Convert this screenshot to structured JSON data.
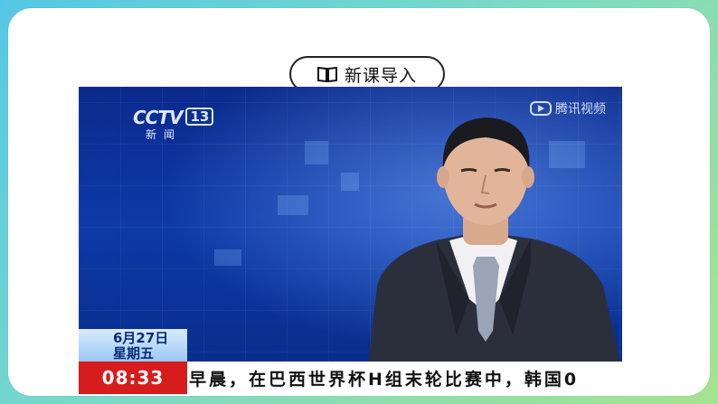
{
  "slide": {
    "section_title": "新课导入",
    "section_icon": "book-icon"
  },
  "video": {
    "channel_logo": "CCTV",
    "channel_number": "13",
    "channel_sub": "新闻",
    "watermark": "腾讯视频",
    "date_line1": "6月27日",
    "date_line2": "星期五",
    "time": "08:33",
    "ticker": "早晨，在巴西世界杯H组末轮比赛中，韩国0"
  },
  "colors": {
    "accent_teal": "#55c7e6",
    "accent_green": "#a6e38f",
    "ticker_red": "#d61c1c",
    "studio_blue": "#0d3aa8"
  }
}
